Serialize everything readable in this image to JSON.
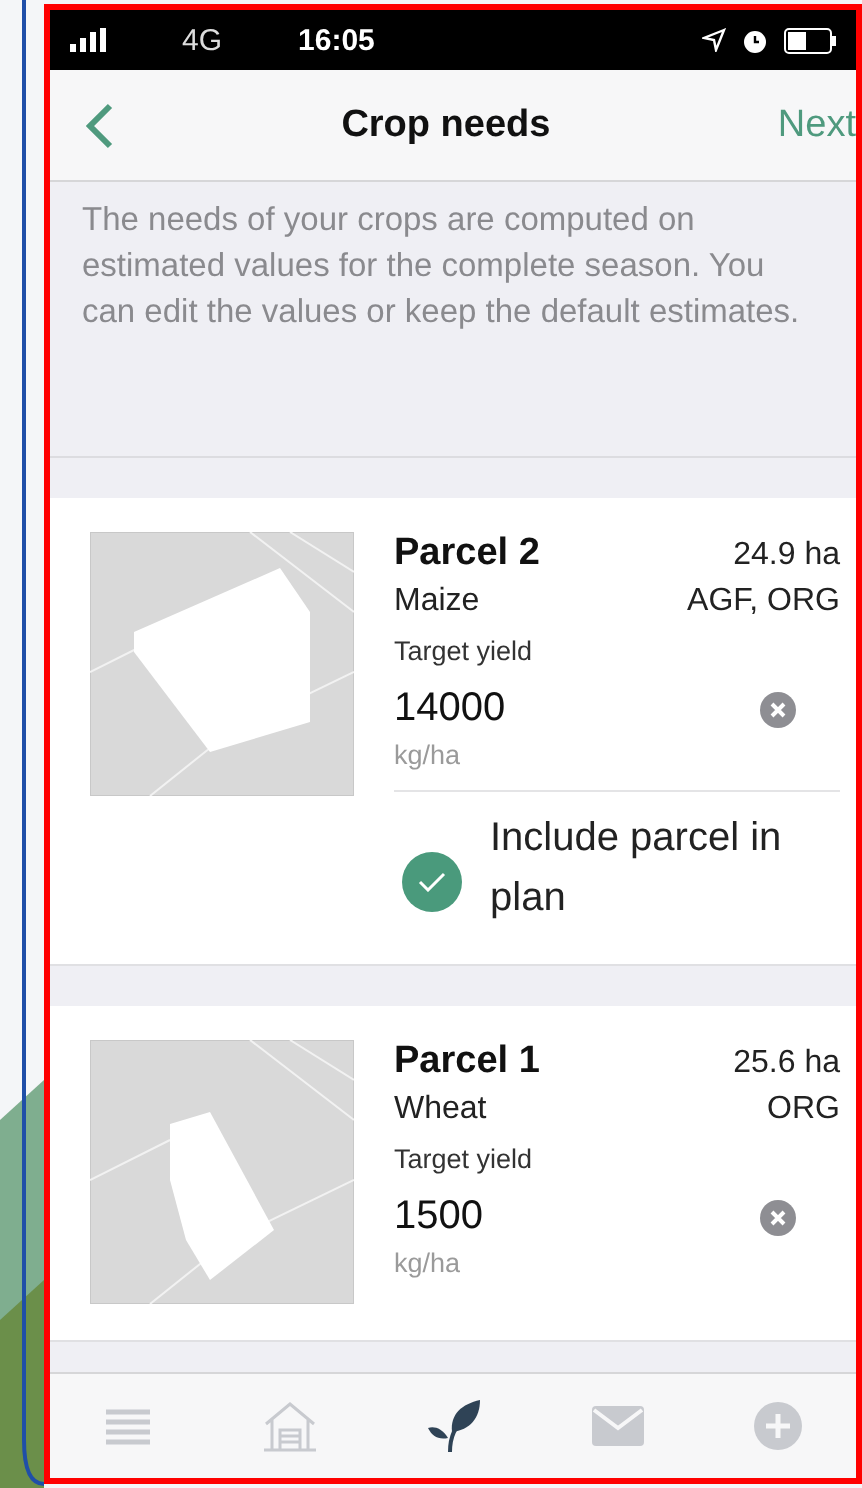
{
  "status_bar": {
    "network": "4G",
    "time": "16:05"
  },
  "nav": {
    "title": "Crop needs",
    "next": "Next"
  },
  "intro": "The needs of your crops are computed on estimated values for the complete season. You can edit the values or keep the default estimates.",
  "parcels": [
    {
      "name": "Parcel 2",
      "area": "24.9 ha",
      "crop": "Maize",
      "tags": "AGF, ORG",
      "yield_label": "Target yield",
      "yield": "14000",
      "unit": "kg/ha",
      "include": {
        "label": "Include parcel in plan",
        "checked": true
      }
    },
    {
      "name": "Parcel 1",
      "area": "25.6 ha",
      "crop": "Wheat",
      "tags": "ORG",
      "yield_label": "Target yield",
      "yield": "1500",
      "unit": "kg/ha"
    }
  ],
  "tab_bar": [
    {
      "kind": "menu",
      "selected": false
    },
    {
      "kind": "farm",
      "selected": false
    },
    {
      "kind": "leaf",
      "selected": true
    },
    {
      "kind": "mail",
      "selected": false
    },
    {
      "kind": "add",
      "selected": false
    }
  ]
}
